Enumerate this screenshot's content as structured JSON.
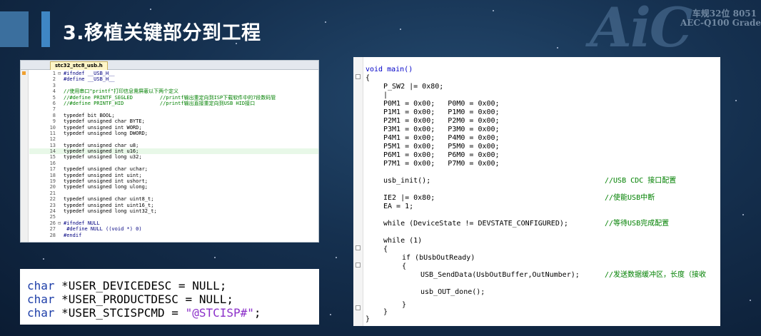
{
  "slide": {
    "title": "3.移植关键部分到工程",
    "logo_text": "AiC",
    "logo_line1": "车规32位 8051",
    "logo_line2": "AEC-Q100 Grade"
  },
  "editor1": {
    "tab_label": "stc32_stc8_usb.h",
    "lines": [
      {
        "n": "1",
        "f": "⊟",
        "code": "#ifndef __USB_H__"
      },
      {
        "n": "2",
        "f": "",
        "code": "#define __USB_H__"
      },
      {
        "n": "3",
        "f": "",
        "code": ""
      },
      {
        "n": "4",
        "f": "",
        "code": "//使用串口\"printf\"打印信息需屏蔽以下两个定义"
      },
      {
        "n": "5",
        "f": "",
        "code": "//#define PRINTF_SEGLED         //printf输出重定向到ISP下载软件中的7段数码管"
      },
      {
        "n": "6",
        "f": "",
        "code": "//#define PRINTF_HID            //printf输出直接重定向到USB HID接口"
      },
      {
        "n": "7",
        "f": "",
        "code": ""
      },
      {
        "n": "8",
        "f": "",
        "code": "typedef bit BOOL;"
      },
      {
        "n": "9",
        "f": "",
        "code": "typedef unsigned char BYTE;"
      },
      {
        "n": "10",
        "f": "",
        "code": "typedef unsigned int WORD;"
      },
      {
        "n": "11",
        "f": "",
        "code": "typedef unsigned long DWORD;"
      },
      {
        "n": "12",
        "f": "",
        "code": ""
      },
      {
        "n": "13",
        "f": "",
        "code": "typedef unsigned char u8;"
      },
      {
        "n": "14",
        "f": "",
        "code": "typedef unsigned int u16;"
      },
      {
        "n": "15",
        "f": "",
        "code": "typedef unsigned long u32;"
      },
      {
        "n": "16",
        "f": "",
        "code": ""
      },
      {
        "n": "17",
        "f": "",
        "code": "typedef unsigned char uchar;"
      },
      {
        "n": "18",
        "f": "",
        "code": "typedef unsigned int uint;"
      },
      {
        "n": "19",
        "f": "",
        "code": "typedef unsigned int ushort;"
      },
      {
        "n": "20",
        "f": "",
        "code": "typedef unsigned long ulong;"
      },
      {
        "n": "21",
        "f": "",
        "code": ""
      },
      {
        "n": "22",
        "f": "",
        "code": "typedef unsigned char uint8_t;"
      },
      {
        "n": "23",
        "f": "",
        "code": "typedef unsigned int uint16_t;"
      },
      {
        "n": "24",
        "f": "",
        "code": "typedef unsigned long uint32_t;"
      },
      {
        "n": "25",
        "f": "",
        "code": ""
      },
      {
        "n": "26",
        "f": "⊟",
        "code": "#ifndef NULL"
      },
      {
        "n": "27",
        "f": "",
        "code": " #define NULL ((void *) 0)"
      },
      {
        "n": "28",
        "f": "",
        "code": "#endif"
      }
    ]
  },
  "snippet": {
    "lines": [
      {
        "kw": "char",
        "rest": " *USER_DEVICEDESC = NULL;",
        "str": ""
      },
      {
        "kw": "char",
        "rest": " *USER_PRODUCTDESC = NULL;",
        "str": ""
      },
      {
        "kw": "char",
        "rest": " *USER_STCISPCMD = ",
        "str": "\"@STCISP#\"",
        "tail": ";"
      }
    ]
  },
  "editor2": {
    "main_sig": "void main()",
    "open_brace": "{",
    "p_sw2": "P_SW2 |= 0x80;",
    "cursor": "|",
    "port_lines": [
      "P0M1 = 0x00;   P0M0 = 0x00;",
      "P1M1 = 0x00;   P1M0 = 0x00;",
      "P2M1 = 0x00;   P2M0 = 0x00;",
      "P3M1 = 0x00;   P3M0 = 0x00;",
      "P4M1 = 0x00;   P4M0 = 0x00;",
      "P5M1 = 0x00;   P5M0 = 0x00;",
      "P6M1 = 0x00;   P6M0 = 0x00;",
      "P7M1 = 0x00;   P7M0 = 0x00;"
    ],
    "usb_init": "usb_init();",
    "usb_init_comment": "//USB CDC 接口配置",
    "ie2": "IE2 |= 0x80;",
    "ie2_comment": "//使能USB中断",
    "ea": "EA = 1;",
    "while_state": "while (DeviceState != DEVSTATE_CONFIGURED);",
    "while_state_comment": "//等待USB完成配置",
    "while_loop": "while (1)",
    "brace_open2": "{",
    "if_ready": "if (bUsbOutReady)",
    "brace_open3": "{",
    "send_data": "USB_SendData(UsbOutBuffer,OutNumber);",
    "send_data_comment": "//发送数据缓冲区，长度（接收",
    "out_done": "usb_OUT_done();",
    "brace_close3": "}",
    "brace_close2": "}",
    "brace_close1": "}"
  }
}
